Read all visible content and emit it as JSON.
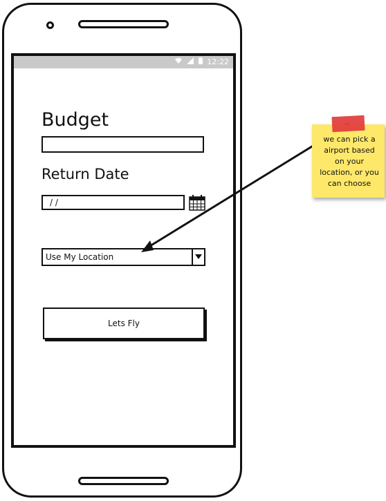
{
  "status_bar": {
    "wifi_icon": "wifi-icon",
    "signal_icon": "signal-icon",
    "battery_icon": "battery-icon",
    "time": "12:22"
  },
  "form": {
    "budget_label": "Budget",
    "budget_value": "",
    "return_date_label": "Return Date",
    "return_date_value": "/  /",
    "calendar_icon": "calendar-icon",
    "location_select_value": "Use My Location",
    "submit_label": "Lets Fly"
  },
  "annotation": {
    "note_text": "we can pick a airport based on your location, or you can choose",
    "note_color": "#fde86a",
    "tape_color": "#e23b3b"
  }
}
